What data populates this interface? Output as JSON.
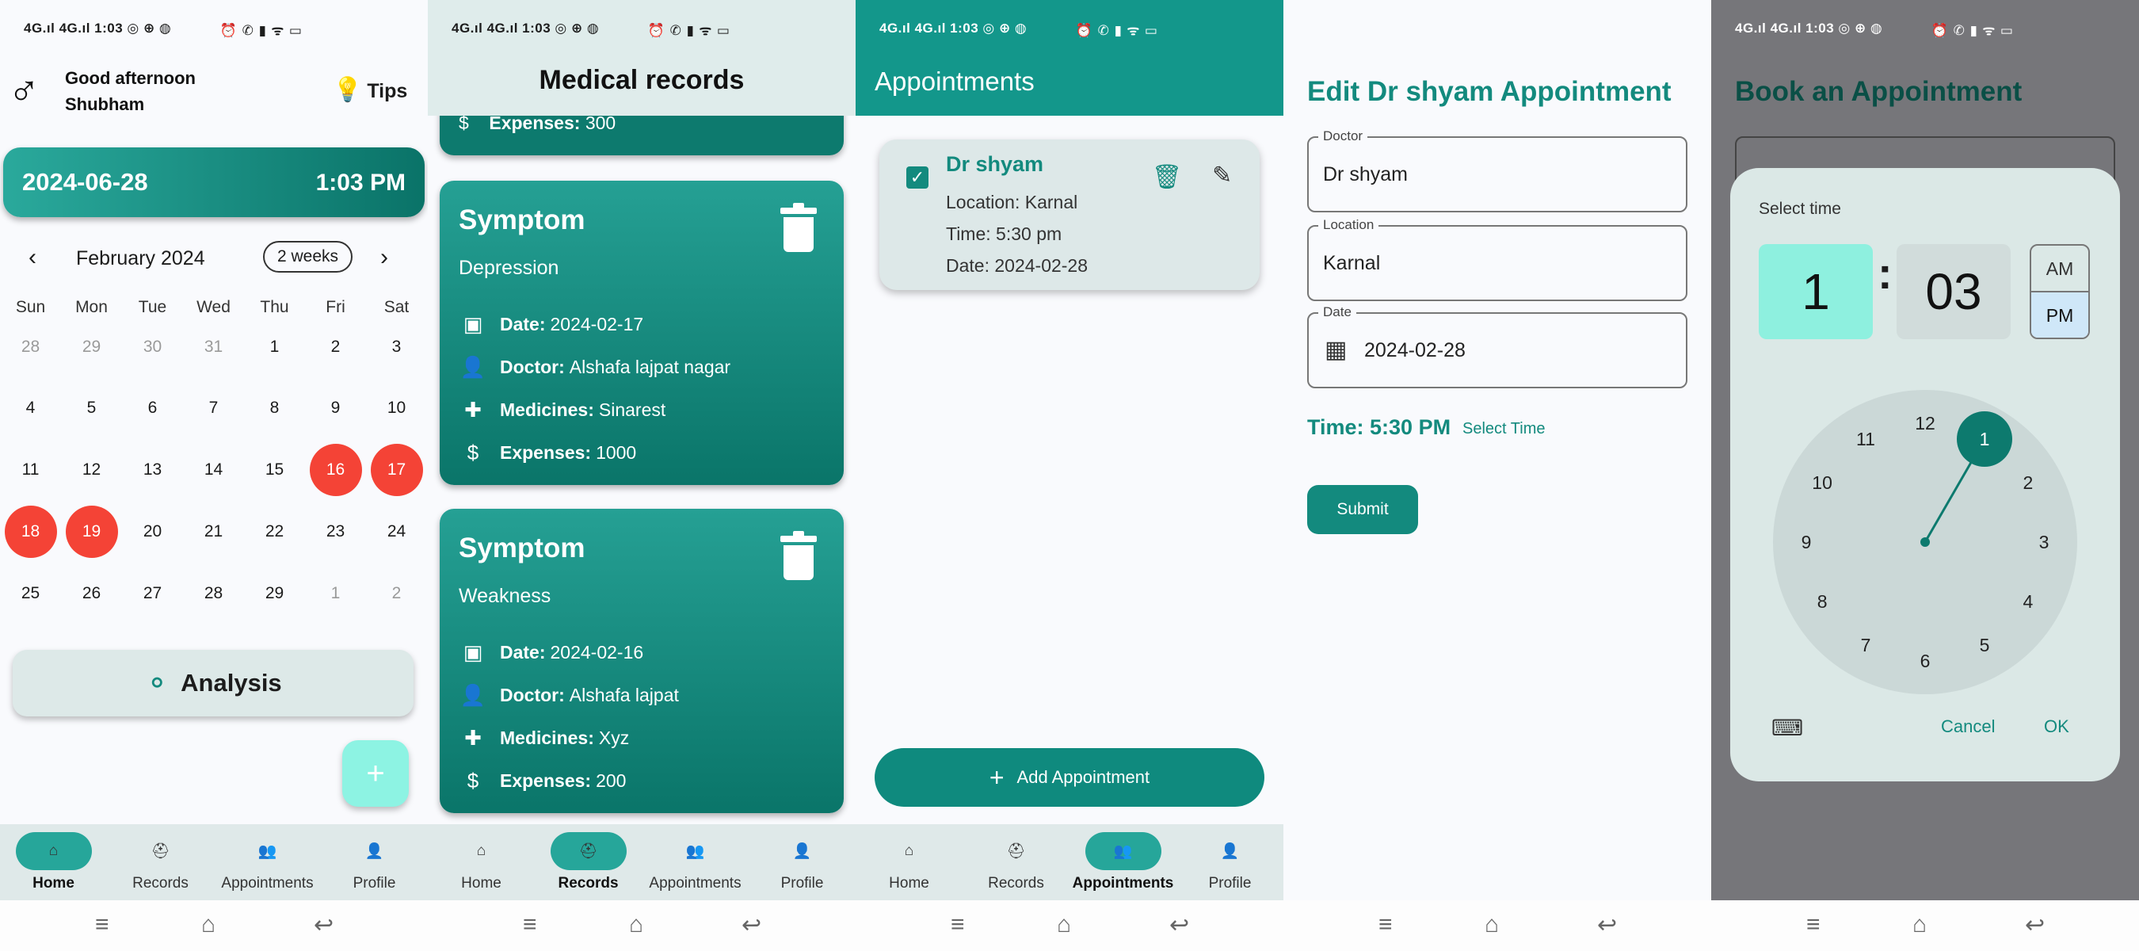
{
  "status_bar": {
    "left": "4G.ıl 4G.ıl 1:03 ◎ ⊕ ◍",
    "right": "⏰ ✆ ▮ ᯤ ▭"
  },
  "bottom_nav": [
    {
      "label": "Home",
      "icon": "home-icon"
    },
    {
      "label": "Records",
      "icon": "medical-bag-icon"
    },
    {
      "label": "Appointments",
      "icon": "people-icon"
    },
    {
      "label": "Profile",
      "icon": "person-icon"
    }
  ],
  "home": {
    "greeting_line1": "Good afternoon",
    "greeting_line2": "Shubham",
    "tips_label": "Tips",
    "date": "2024-06-28",
    "time": "1:03 PM",
    "calendar": {
      "month": "February 2024",
      "format_button": "2 weeks",
      "weekdays": [
        "Sun",
        "Mon",
        "Tue",
        "Wed",
        "Thu",
        "Fri",
        "Sat"
      ],
      "weeks": [
        [
          "28",
          "29",
          "30",
          "31",
          "1",
          "2",
          "3"
        ],
        [
          "4",
          "5",
          "6",
          "7",
          "8",
          "9",
          "10"
        ],
        [
          "11",
          "12",
          "13",
          "14",
          "15",
          "16",
          "17"
        ],
        [
          "18",
          "19",
          "20",
          "21",
          "22",
          "23",
          "24"
        ],
        [
          "25",
          "26",
          "27",
          "28",
          "29",
          "1",
          "2"
        ]
      ],
      "highlighted_days": [
        "16",
        "17",
        "18",
        "19"
      ],
      "highlight_color": "#f44336"
    },
    "analysis_label": "Analysis",
    "fab_label": "+"
  },
  "records": {
    "title": "Medical records",
    "partial_expenses_label": "Expenses:",
    "partial_expenses_value": "300",
    "cards": [
      {
        "heading": "Symptom",
        "condition": "Depression",
        "date_label": "Date:",
        "date": "2024-02-17",
        "doctor_label": "Doctor:",
        "doctor": "Alshafa lajpat nagar",
        "medicines_label": "Medicines:",
        "medicines": "Sinarest",
        "expenses_label": "Expenses:",
        "expenses": "1000"
      },
      {
        "heading": "Symptom",
        "condition": "Weakness",
        "date_label": "Date:",
        "date": "2024-02-16",
        "doctor_label": "Doctor:",
        "doctor": "Alshafa lajpat",
        "medicines_label": "Medicines:",
        "medicines": "Xyz",
        "expenses_label": "Expenses:",
        "expenses": "200"
      }
    ]
  },
  "appointments": {
    "title": "Appointments",
    "card": {
      "doctor": "Dr shyam",
      "location": "Location: Karnal",
      "time": "Time: 5:30 pm",
      "date": "Date: 2024-02-28"
    },
    "add_button": "Add Appointment"
  },
  "edit": {
    "title": "Edit Dr shyam Appointment",
    "doctor_label": "Doctor",
    "doctor_value": "Dr shyam",
    "location_label": "Location",
    "location_value": "Karnal",
    "date_label": "Date",
    "date_value": "2024-02-28",
    "time_text": "Time: 5:30 PM",
    "select_time": "Select Time",
    "submit": "Submit"
  },
  "book": {
    "title": "Book an Appointment",
    "dialog_title": "Select time",
    "hour": "1",
    "minute": "03",
    "am": "AM",
    "pm": "PM",
    "selected_period": "PM",
    "clock_numbers": [
      "12",
      "1",
      "2",
      "3",
      "4",
      "5",
      "6",
      "7",
      "8",
      "9",
      "10",
      "11"
    ],
    "selected_hour": "1",
    "cancel": "Cancel",
    "ok": "OK",
    "accent": "#0d7a6e"
  },
  "colors": {
    "primary": "#138a7e",
    "accent_light": "#8df3e3",
    "header_teal": "#13978b"
  }
}
